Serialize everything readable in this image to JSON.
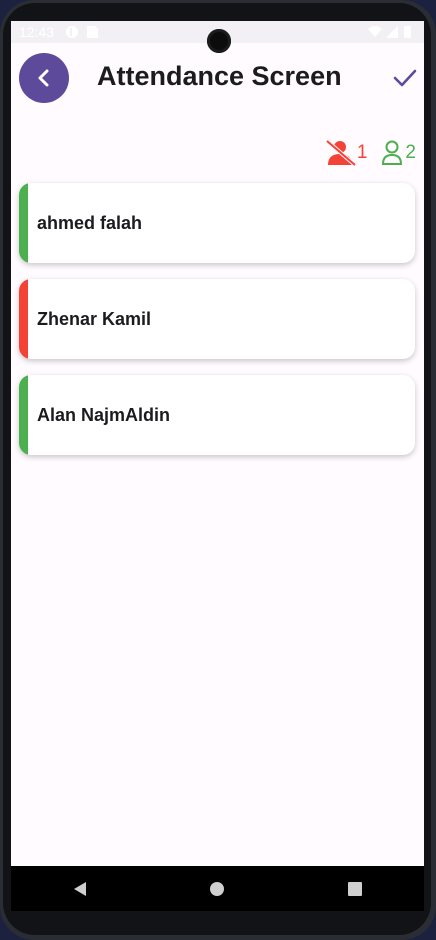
{
  "status_bar": {
    "time": "12:43"
  },
  "header": {
    "title": "Attendance Screen"
  },
  "counters": {
    "absent_count": "1",
    "present_count": "2"
  },
  "students": [
    {
      "name": "ahmed falah",
      "status": "present",
      "color": "#4caf50"
    },
    {
      "name": "Zhenar Kamil",
      "status": "absent",
      "color": "#f44336"
    },
    {
      "name": "Alan NajmAldin",
      "status": "present",
      "color": "#4caf50"
    }
  ],
  "colors": {
    "accent": "#5e4a9b",
    "present": "#4caf50",
    "absent": "#f44336"
  },
  "icons": {
    "back": "chevron-left-icon",
    "confirm": "check-icon",
    "absent": "user-off-icon",
    "present": "user-icon"
  }
}
